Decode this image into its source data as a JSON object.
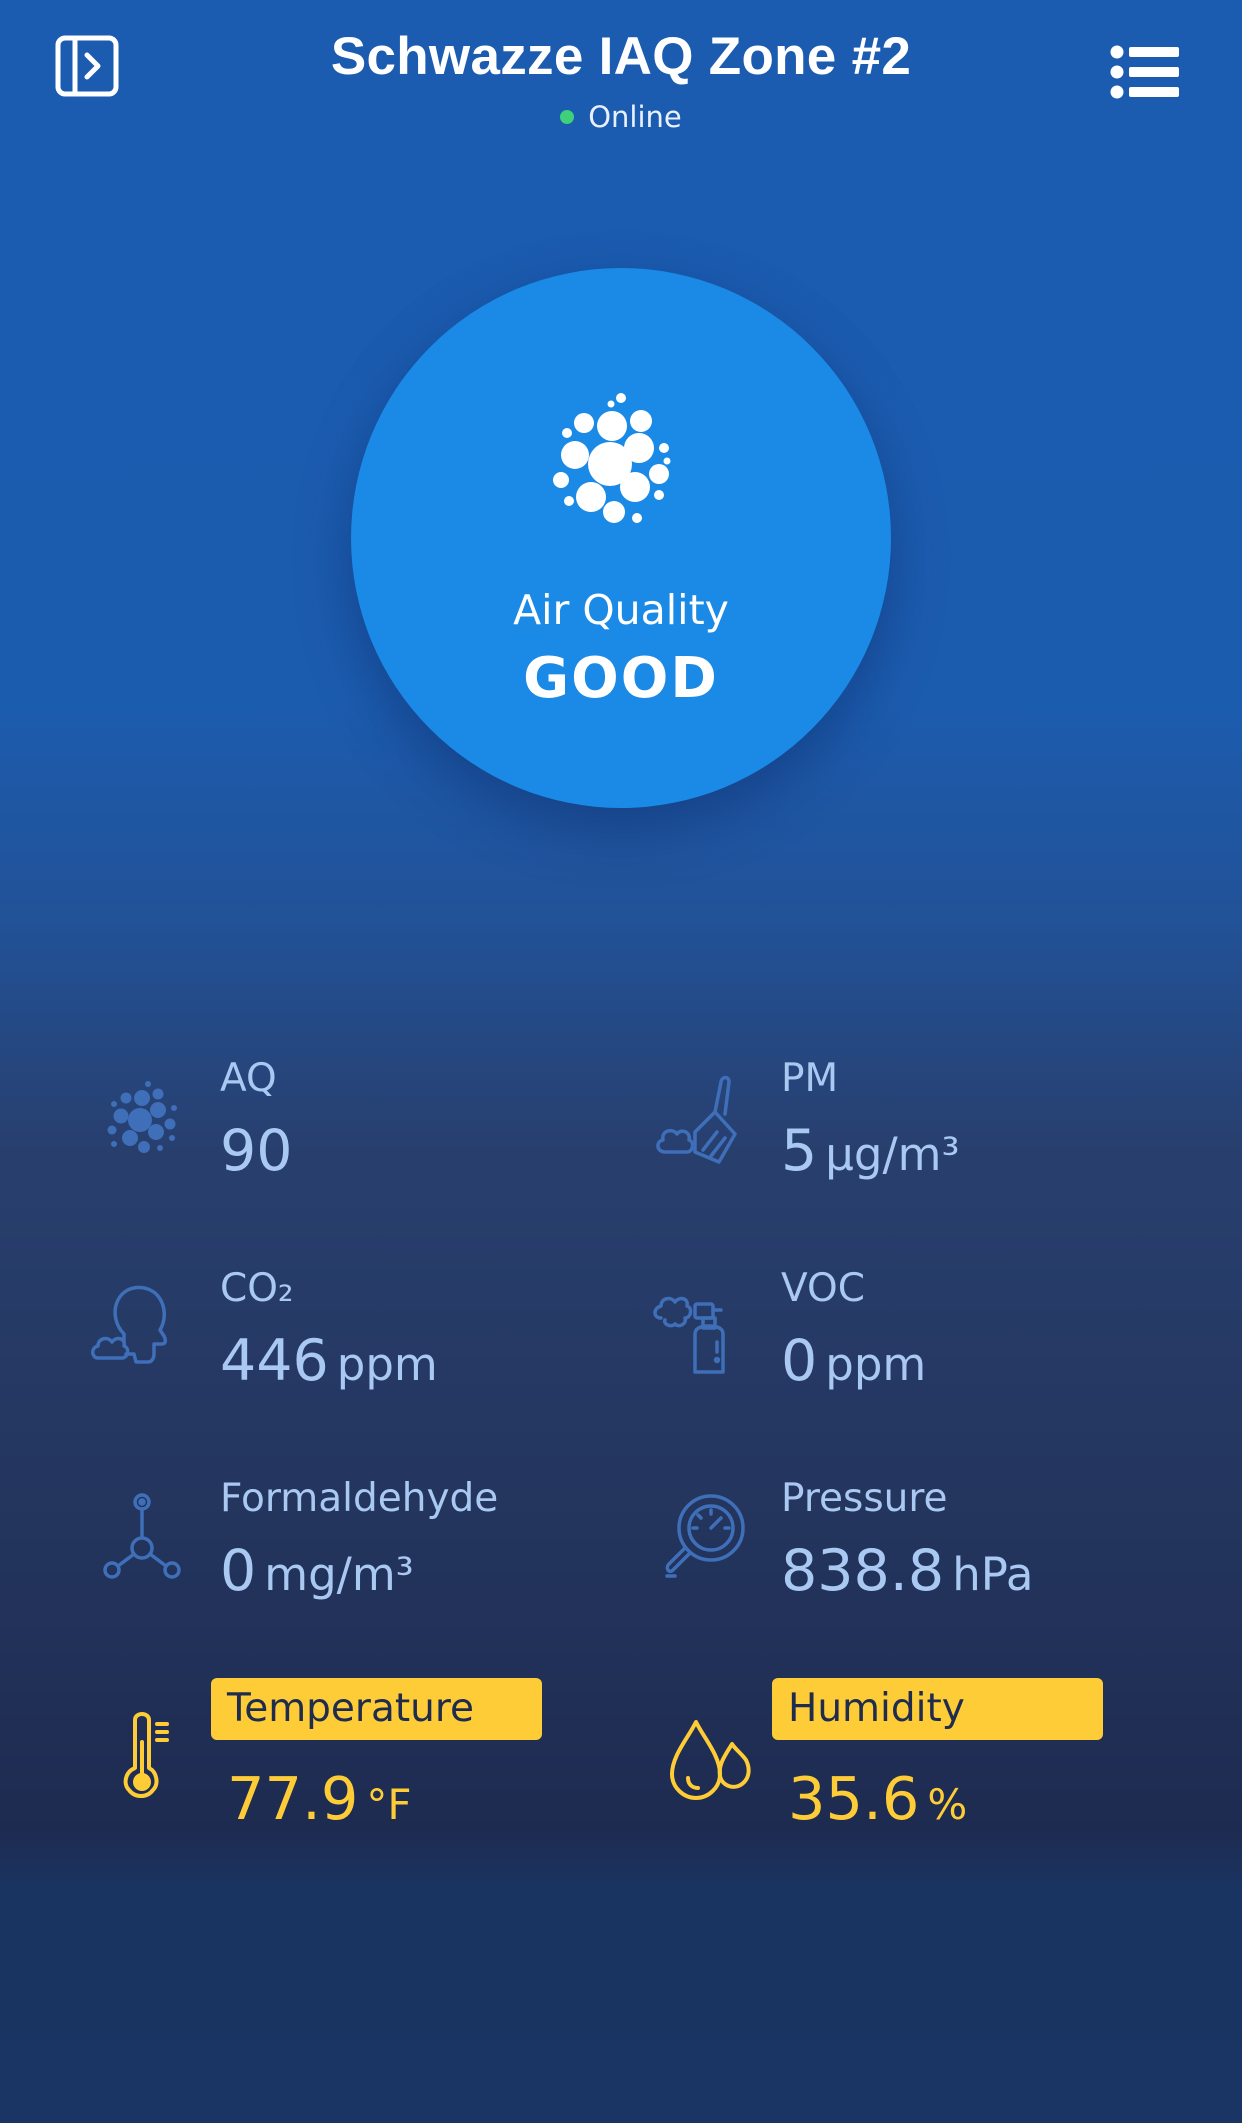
{
  "header": {
    "title": "Schwazze IAQ Zone #2",
    "status": "Online",
    "status_color": "#3fd07a"
  },
  "air_quality": {
    "label": "Air Quality",
    "status": "GOOD",
    "icon": "particles-icon",
    "circle_color": "#1a8ae6"
  },
  "metrics": {
    "aq": {
      "label": "AQ",
      "value": "90",
      "unit": "",
      "icon": "particles-icon"
    },
    "pm": {
      "label": "PM",
      "value": "5",
      "unit": "μg/m³",
      "icon": "dust-broom-icon"
    },
    "co2": {
      "label": "CO₂",
      "value": "446",
      "unit": "ppm",
      "icon": "breath-head-icon"
    },
    "voc": {
      "label": "VOC",
      "value": "0",
      "unit": "ppm",
      "icon": "spray-bottle-icon"
    },
    "formaldehyde": {
      "label": "Formaldehyde",
      "value": "0",
      "unit": "mg/m³",
      "icon": "molecule-icon"
    },
    "pressure": {
      "label": "Pressure",
      "value": "838.8",
      "unit": "hPa",
      "icon": "pressure-gauge-icon"
    },
    "temperature": {
      "label": "Temperature",
      "value": "77.9",
      "unit": "°F",
      "icon": "thermometer-icon",
      "highlighted": true
    },
    "humidity": {
      "label": "Humidity",
      "value": "35.6",
      "unit": "%",
      "icon": "water-drops-icon",
      "highlighted": true
    }
  },
  "colors": {
    "metric_text": "#a9c8f2",
    "highlight": "#fecc36"
  }
}
